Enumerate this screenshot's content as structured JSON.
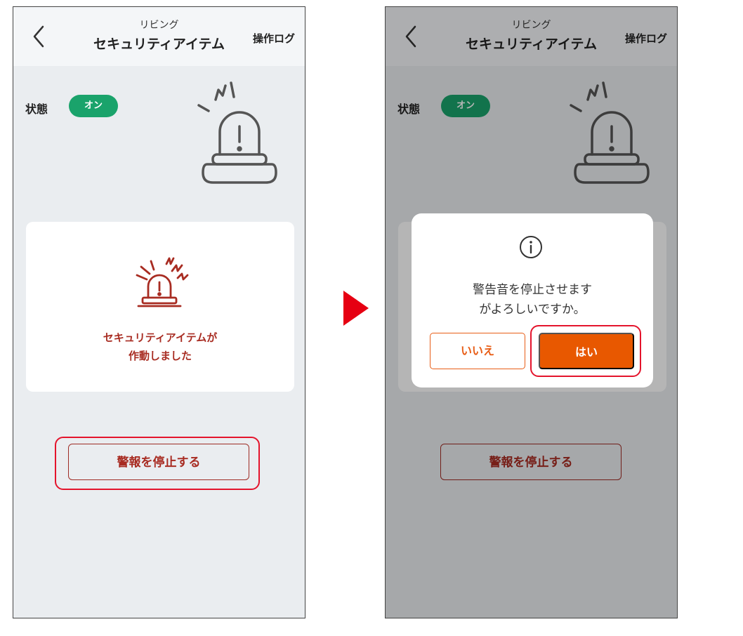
{
  "header": {
    "subtitle": "リビング",
    "title": "セキュリティアイテム",
    "log_label": "操作ログ"
  },
  "status": {
    "label": "状態",
    "value": "オン"
  },
  "alert_card": {
    "line1": "セキュリティアイテムが",
    "line2": "作動しました"
  },
  "stop_button": {
    "label": "警報を停止する"
  },
  "dialog": {
    "line1": "警告音を停止させます",
    "line2": "がよろしいですか。",
    "no_label": "いいえ",
    "yes_label": "はい"
  },
  "icons": {
    "back": "chevron-left-icon",
    "siren": "siren-icon",
    "alarm": "alarm-icon",
    "info": "info-icon",
    "arrow": "arrow-right-icon"
  },
  "colors": {
    "status_on": "#1aa36b",
    "alert_red": "#a82c22",
    "highlight_red": "#e4142c",
    "yes_orange": "#e85800",
    "no_orange_border": "#e85d16",
    "screen_bg": "#eaedf0"
  }
}
